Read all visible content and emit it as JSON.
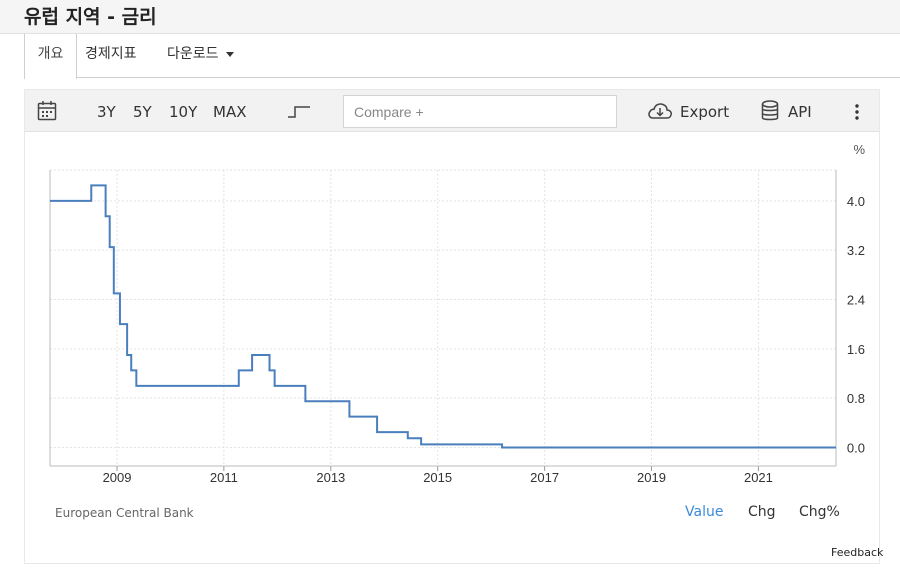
{
  "page": {
    "title": "유럽 지역 - 금리"
  },
  "tabs": [
    {
      "label": "개요",
      "active": true
    },
    {
      "label": "경제지표",
      "active": false
    },
    {
      "label": "다운로드",
      "active": false
    }
  ],
  "toolbar": {
    "calendar_icon": "calendar-icon",
    "ranges": [
      "3Y",
      "5Y",
      "10Y",
      "MAX"
    ],
    "step_icon": "step-line-icon",
    "compare_placeholder": "Compare +",
    "export_label": "Export",
    "api_label": "API",
    "more_icon": "kebab-icon"
  },
  "footer": {
    "source": "European Central Bank",
    "modes": [
      "Value",
      "Chg",
      "Chg%"
    ],
    "active_mode": "Value",
    "feedback": "Feedback"
  },
  "colors": {
    "line": "#4a7fbd",
    "active_mode": "#3b8ad9"
  },
  "chart_data": {
    "type": "line",
    "step": true,
    "ylabel": "%",
    "ylim": [
      -0.3,
      4.5
    ],
    "xlim": [
      "2007-10-01",
      "2022-06-15"
    ],
    "x_ticks": [
      "2009",
      "2011",
      "2013",
      "2015",
      "2017",
      "2019",
      "2021"
    ],
    "y_ticks": [
      "0.0",
      "0.8",
      "1.6",
      "2.4",
      "3.2",
      "4.0"
    ],
    "grid": true,
    "series": [
      {
        "x": [
          "2007-10-01",
          "2008-07-09",
          "2008-10-15",
          "2008-11-12",
          "2008-12-10",
          "2009-01-21",
          "2009-03-11",
          "2009-04-08",
          "2009-05-13",
          "2011-04-13",
          "2011-07-13",
          "2011-11-09",
          "2011-12-14",
          "2012-07-11",
          "2013-05-08",
          "2013-11-13",
          "2014-06-11",
          "2014-09-10",
          "2016-03-16",
          "2022-06-15"
        ],
        "y": [
          4.0,
          4.25,
          3.75,
          3.25,
          2.5,
          2.0,
          1.5,
          1.25,
          1.0,
          1.25,
          1.5,
          1.25,
          1.0,
          0.75,
          0.5,
          0.25,
          0.15,
          0.05,
          0.0,
          0.0
        ]
      }
    ]
  }
}
